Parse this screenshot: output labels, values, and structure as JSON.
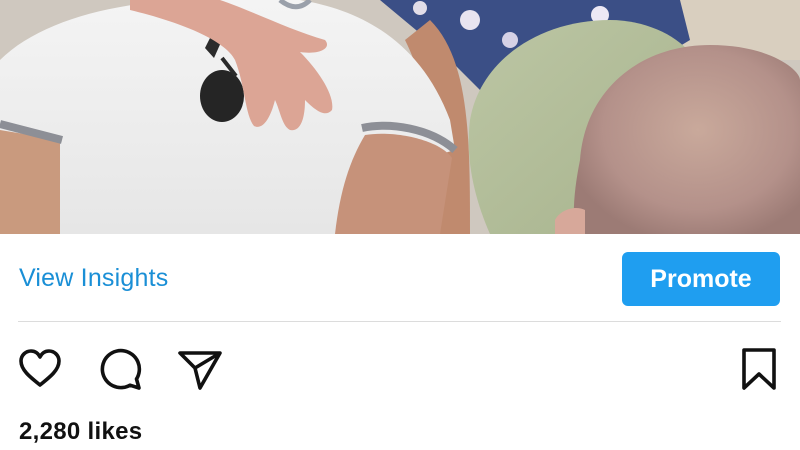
{
  "post": {
    "photo_icon": "photo-image",
    "insights_label": "View Insights",
    "promote_label": "Promote",
    "likes_text": "2,280 likes"
  },
  "actions": {
    "like_icon": "heart-outline-icon",
    "comment_icon": "speech-bubble-icon",
    "share_icon": "paper-plane-icon",
    "save_icon": "bookmark-icon"
  },
  "colors": {
    "link_blue": "#1a8fd6",
    "button_blue": "#1f9ef0",
    "text": "#111111"
  }
}
